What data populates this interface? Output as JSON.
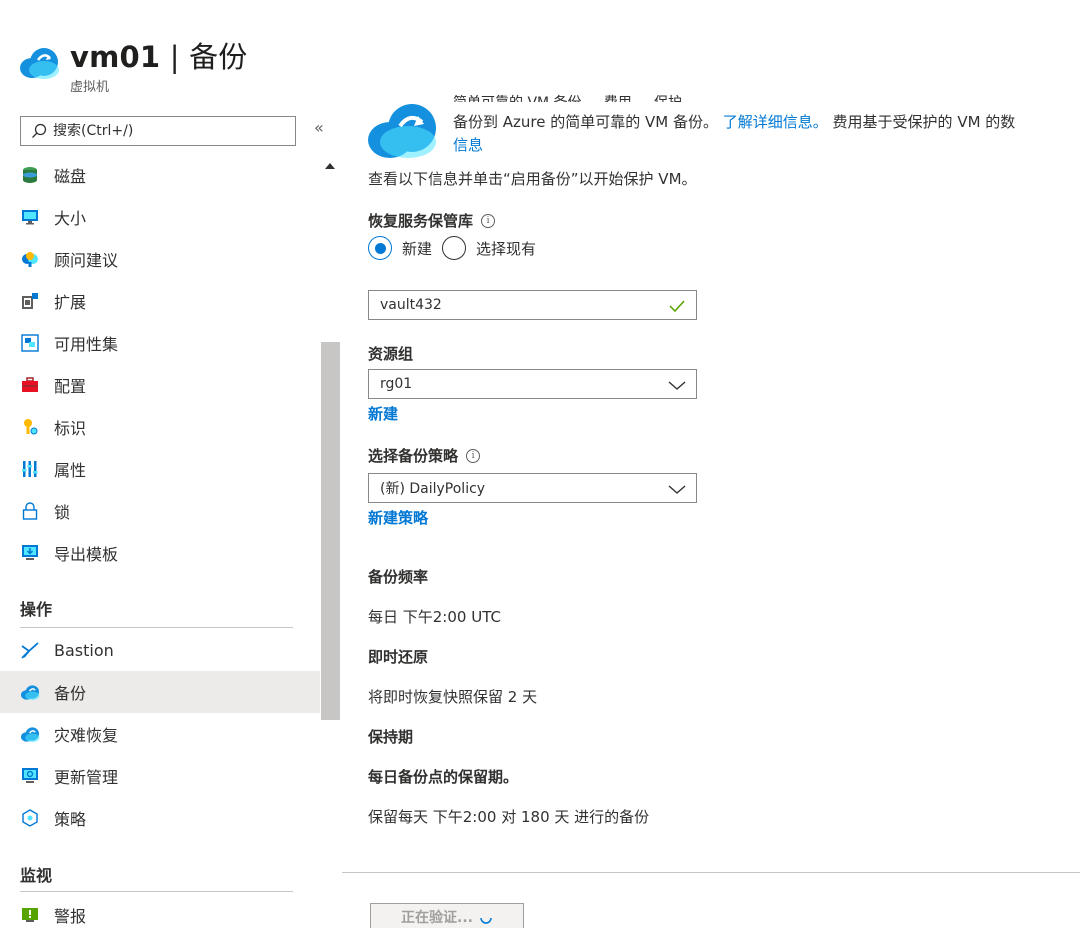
{
  "header": {
    "title_bold": "vm01",
    "title_rest": " | 备份",
    "subtitle": "虚拟机"
  },
  "sidebar": {
    "search_placeholder": "搜索(Ctrl+/)",
    "collapse_glyph": "«",
    "items": [
      {
        "label": "磁盘",
        "icon": "disk-icon"
      },
      {
        "label": "大小",
        "icon": "monitor-icon"
      },
      {
        "label": "顾问建议",
        "icon": "advisor-icon"
      },
      {
        "label": "扩展",
        "icon": "extensions-icon"
      },
      {
        "label": "可用性集",
        "icon": "availability-set-icon"
      },
      {
        "label": "配置",
        "icon": "toolbox-icon"
      },
      {
        "label": "标识",
        "icon": "key-icon"
      },
      {
        "label": "属性",
        "icon": "properties-icon"
      },
      {
        "label": "锁",
        "icon": "lock-icon"
      },
      {
        "label": "导出模板",
        "icon": "export-template-icon"
      }
    ],
    "section_operations": "操作",
    "operations_items": [
      {
        "label": "Bastion",
        "icon": "bastion-icon"
      },
      {
        "label": "备份",
        "icon": "backup-cloud-icon"
      },
      {
        "label": "灾难恢复",
        "icon": "disaster-recovery-icon"
      },
      {
        "label": "更新管理",
        "icon": "update-management-icon"
      },
      {
        "label": "策略",
        "icon": "policy-icon"
      }
    ],
    "section_monitoring": "监视",
    "monitoring_items": [
      {
        "label": "警报",
        "icon": "alert-icon"
      }
    ]
  },
  "main": {
    "banner_cut_text": "简单可靠的 VM 备份 ... 费用 ... 保护",
    "banner_text": "备份到 Azure 的简单可靠的 VM 备份。",
    "banner_link1": "了解详细信息。",
    "banner_text2": " 费用基于受保护的 VM 的数",
    "banner_link2": "信息",
    "intro": "查看以下信息并单击“启用备份”以开始保护 VM。",
    "vault_label": "恢复服务保管库",
    "radio_new": "新建",
    "radio_existing": "选择现有",
    "vault_value": "vault432",
    "rg_label": "资源组",
    "rg_value": "rg01",
    "rg_new_link": "新建",
    "policy_label": "选择备份策略",
    "policy_value": "(新) DailyPolicy",
    "policy_new_link": "新建策略",
    "freq_label": "备份频率",
    "freq_value": "每日 下午2:00 UTC",
    "instant_label": "即时还原",
    "instant_value": "将即时恢复快照保留 2 天",
    "retention_label": "保持期",
    "daily_retention_label": "每日备份点的保留期。",
    "daily_retention_value": "保留每天 下午2:00 对 180 天 进行的备份",
    "validate_button": "正在验证..."
  },
  "colors": {
    "accent": "#0078d4",
    "valid_check": "#57a300",
    "selected_bg": "#edebe9"
  }
}
